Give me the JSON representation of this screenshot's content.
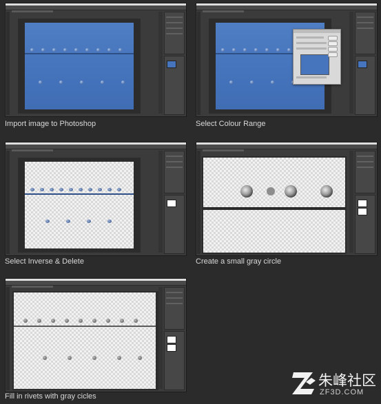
{
  "steps": [
    {
      "id": 1,
      "caption": "Import image to Photoshop"
    },
    {
      "id": 2,
      "caption": "Select Colour Range"
    },
    {
      "id": 3,
      "caption": "Select Inverse & Delete"
    },
    {
      "id": 4,
      "caption": "Create a small gray circle"
    },
    {
      "id": 5,
      "caption": "Fill in  rivets with gray cicles"
    }
  ],
  "watermark": {
    "site_name": "朱峰社区",
    "url": "ZF3D.COM"
  },
  "colors": {
    "page_background": "#2b2b2b",
    "photoshop_workspace": "#3b3b3b",
    "metal_blue": "#4675bd",
    "caption_text": "#d8d8d8"
  },
  "icons": {
    "watermark_logo": "zf-logo-icon"
  }
}
